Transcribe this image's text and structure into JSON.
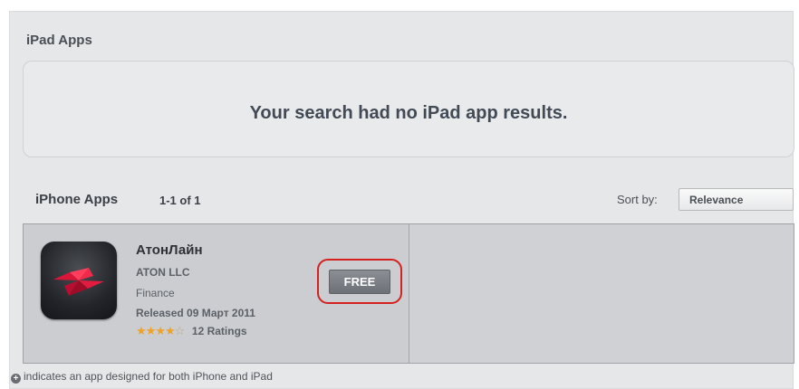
{
  "ipad_section": {
    "title": "iPad Apps",
    "empty_message": "Your search had no iPad app results."
  },
  "iphone_section": {
    "title": "iPhone Apps",
    "count": "1-1 of 1",
    "sort_label": "Sort by:",
    "sort_value": "Relevance"
  },
  "app": {
    "icon": "atonline-app-icon",
    "name": "АтонЛайн",
    "developer": "ATON LLC",
    "category": "Finance",
    "released": "Released 09 Март 2011",
    "stars_filled": 4,
    "stars_total": 5,
    "ratings": "12 Ratings",
    "price_label": "FREE"
  },
  "footnote": {
    "icon": "plus-icon",
    "text": "indicates an app designed for both iPhone and iPad"
  },
  "colors": {
    "background": "#e6e7e8",
    "star": "#f0a127",
    "highlight": "#d42020",
    "button": "#7a7e84"
  }
}
